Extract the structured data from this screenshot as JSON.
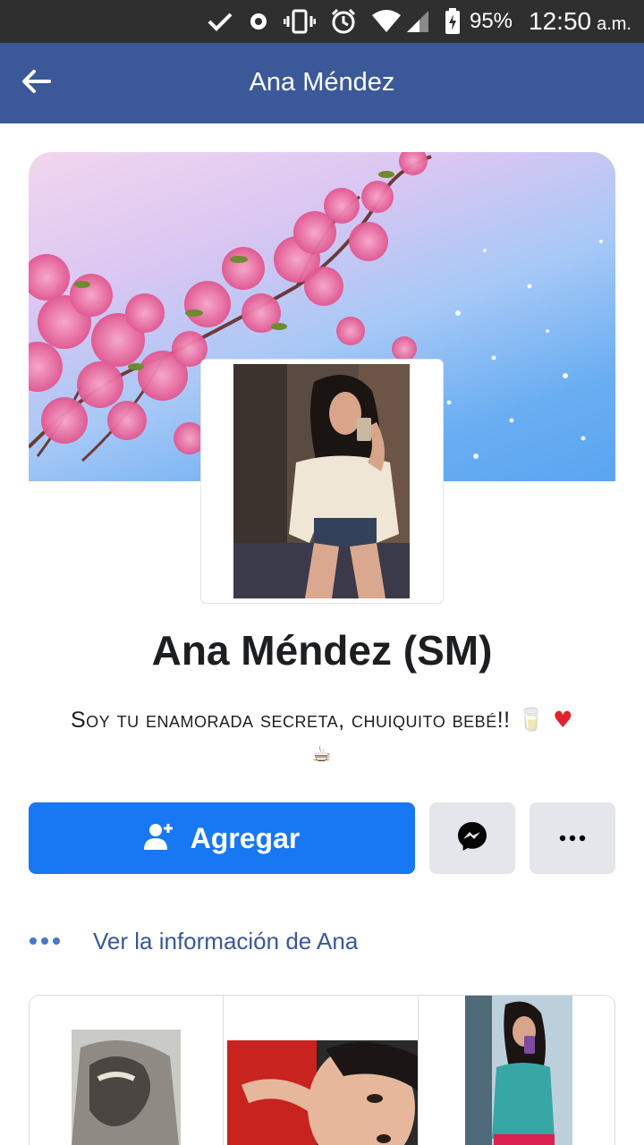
{
  "status_bar": {
    "battery": "95%",
    "time": "12:50",
    "ampm": "a.m."
  },
  "app_bar": {
    "title": "Ana Méndez"
  },
  "profile": {
    "name": "Ana Méndez (SM)",
    "bio_text": "Soy tu enamorada secreta, chuiquito bebé!!",
    "bio_emoji": "🥛 ♥",
    "bio_emoji2": "☕"
  },
  "actions": {
    "add_label": "Agregar"
  },
  "info_link": {
    "label": "Ver la información de Ana"
  },
  "colors": {
    "app_bar": "#3b5998",
    "primary_button": "#1877f2",
    "link": "#385898",
    "status_bar": "#2f2f2f"
  },
  "icons": {
    "back": "arrow-left-icon",
    "add_friend": "add-person-icon",
    "messenger": "messenger-icon",
    "more": "more-horizontal-icon",
    "info": "ellipsis-icon"
  }
}
